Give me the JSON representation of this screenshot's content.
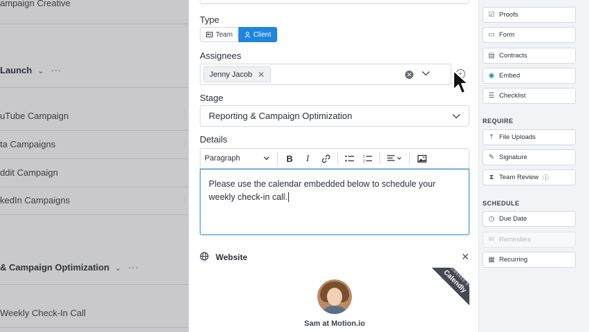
{
  "left_panel": {
    "items": [
      {
        "label": "ampaign Creative",
        "kind": "task"
      },
      {
        "label": "Launch",
        "kind": "section"
      },
      {
        "label": "uTube Campaign",
        "kind": "task"
      },
      {
        "label": "ta Campaigns",
        "kind": "task"
      },
      {
        "label": "ddit Campaign",
        "kind": "task"
      },
      {
        "label": "kedIn Campaigns",
        "kind": "task"
      },
      {
        "label": "& Campaign Optimization",
        "kind": "section"
      },
      {
        "label": "Weekly Check-In Call",
        "kind": "task"
      }
    ],
    "section_chevron": "⌄",
    "section_dots": "···",
    "drag_handle": "⋮⋮"
  },
  "form": {
    "type_label": "Type",
    "type_options": [
      {
        "label": "Team",
        "icon": "team-card-icon",
        "selected": false
      },
      {
        "label": "Client",
        "icon": "client-person-icon",
        "selected": true
      }
    ],
    "assignees_label": "Assignees",
    "assignees": [
      {
        "name": "Jenny Jacob"
      }
    ],
    "stage_label": "Stage",
    "stage_value": "Reporting & Campaign Optimization",
    "details_label": "Details",
    "toolbar": {
      "paragraph_label": "Paragraph",
      "bold": "B",
      "italic": "I"
    },
    "details_text": "Please use the calendar embedded below to schedule your weekly check-in call.",
    "website_label": "Website",
    "embed": {
      "host_name": "Sam at Motion.io",
      "ribbon_small": "POWERED BY",
      "ribbon_brand": "Calendly"
    }
  },
  "palette": {
    "groups": [
      {
        "heading": "",
        "items": [
          {
            "label": "Proofs",
            "icon": "proofs-icon",
            "glyph": "☑",
            "disabled": false
          },
          {
            "label": "Form",
            "icon": "form-icon",
            "glyph": "▭",
            "disabled": false
          },
          {
            "label": "Contracts",
            "icon": "contracts-icon",
            "glyph": "▤",
            "disabled": false
          },
          {
            "label": "Embed",
            "icon": "embed-icon",
            "glyph": "◉",
            "disabled": false
          },
          {
            "label": "Checklist",
            "icon": "checklist-icon",
            "glyph": "☰",
            "disabled": false
          }
        ]
      },
      {
        "heading": "REQUIRE",
        "items": [
          {
            "label": "File Uploads",
            "icon": "upload-icon",
            "glyph": "⤒",
            "disabled": false
          },
          {
            "label": "Signature",
            "icon": "signature-icon",
            "glyph": "✎",
            "disabled": false
          },
          {
            "label": "Team Review",
            "icon": "hourglass-icon",
            "glyph": "⧗",
            "disabled": false
          }
        ]
      },
      {
        "heading": "SCHEDULE",
        "items": [
          {
            "label": "Due Date",
            "icon": "clock-icon",
            "glyph": "◷",
            "disabled": false
          },
          {
            "label": "Reminders",
            "icon": "reminders-icon",
            "glyph": "✉",
            "disabled": true
          },
          {
            "label": "Recurring",
            "icon": "calendar-icon",
            "glyph": "▦",
            "disabled": false
          }
        ]
      }
    ]
  },
  "colors": {
    "accent": "#1f86e0",
    "overlay": "#c9c9cb",
    "palette_bg": "#f1f3f6"
  }
}
